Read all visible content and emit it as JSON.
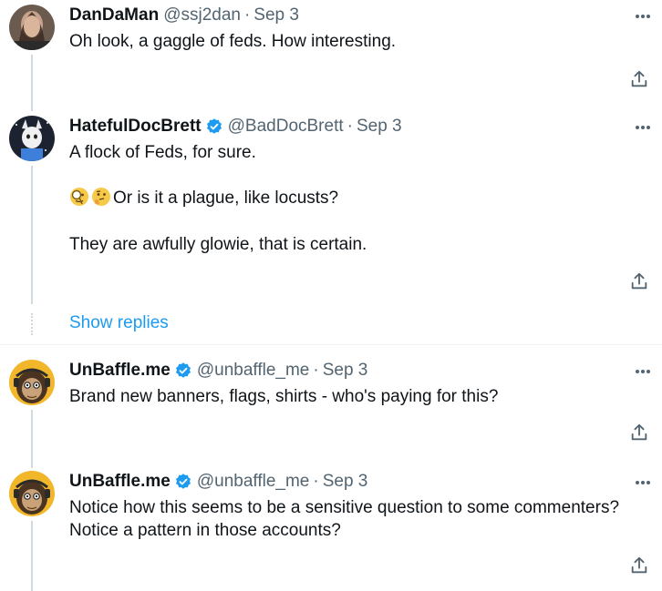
{
  "tweets": [
    {
      "name": "DanDaMan",
      "handle": "@ssj2dan",
      "separator": "·",
      "date": "Sep 3",
      "verified": false,
      "lines": [
        "Oh look, a gaggle of feds. How interesting."
      ]
    },
    {
      "name": "HatefulDocBrett",
      "handle": "@BadDocBrett",
      "separator": "·",
      "date": "Sep 3",
      "verified": true,
      "lines": [
        "A flock of Feds, for sure.",
        "Or is it a plague, like locusts?",
        "They are awfully glowie, that is certain."
      ]
    },
    {
      "name": "UnBaffle.me",
      "handle": "@unbaffle_me",
      "separator": "·",
      "date": "Sep 3",
      "verified": true,
      "lines": [
        "Brand new banners, flags, shirts - who's paying for this?"
      ]
    },
    {
      "name": "UnBaffle.me",
      "handle": "@unbaffle_me",
      "separator": "·",
      "date": "Sep 3",
      "verified": true,
      "lines": [
        "Notice how this seems to be a sensitive question to some commenters?",
        "Notice a pattern in those accounts?"
      ]
    }
  ],
  "show_replies": "Show replies",
  "icons": {
    "more": "more-icon",
    "share": "share-icon",
    "verified": "verified-badge-icon",
    "emoji_1": "magnifier-emoji-icon",
    "emoji_2": "thinking-face-emoji-icon"
  },
  "colors": {
    "accent": "#1d9bf0",
    "secondary_text": "#536471",
    "thread_line": "#cfd9de"
  }
}
